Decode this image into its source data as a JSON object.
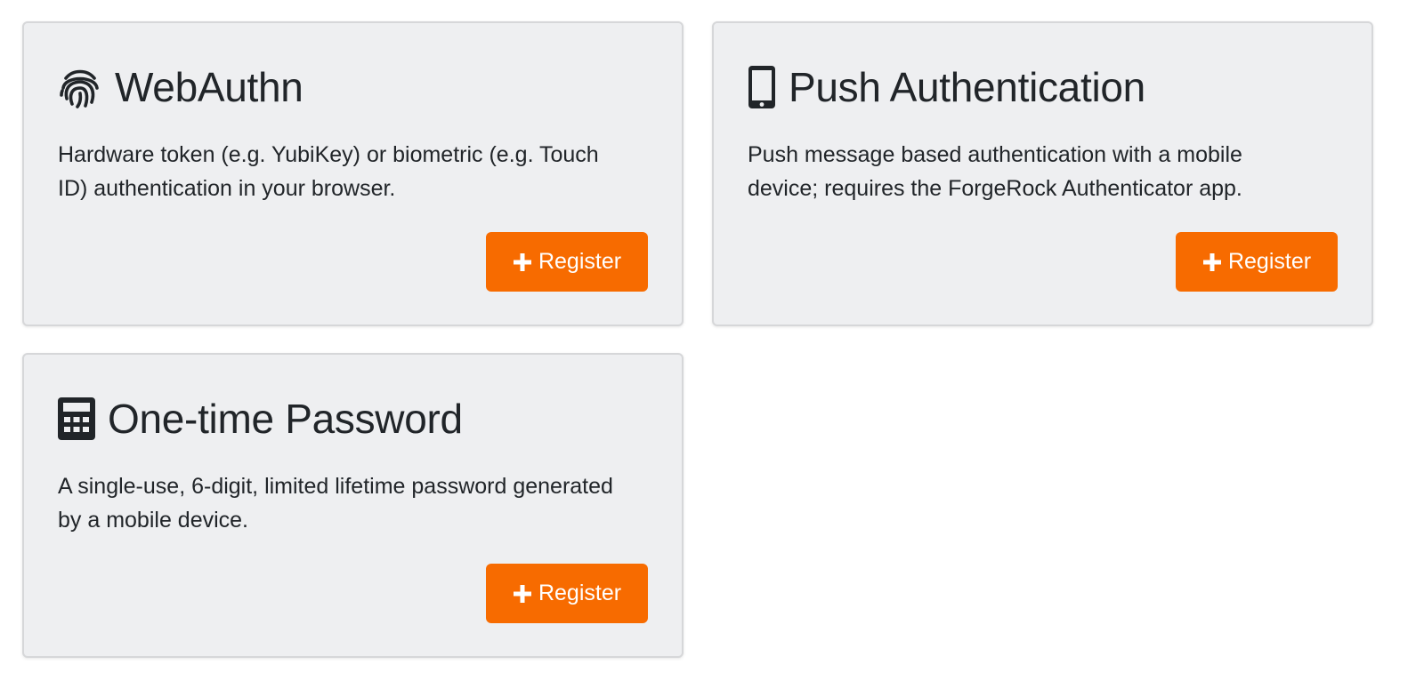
{
  "cards": [
    {
      "title": "WebAuthn",
      "icon": "fingerprint-icon",
      "description": "Hardware token (e.g. YubiKey) or biometric (e.g. Touch ID) authentication in your browser.",
      "button_label": "Register"
    },
    {
      "title": "Push Authentication",
      "icon": "mobile-phone-icon",
      "description": "Push message based authentication with a mobile device; requires the ForgeRock Authenticator app.",
      "button_label": "Register"
    },
    {
      "title": "One-time Password",
      "icon": "calculator-icon",
      "description": "A single-use, 6-digit, limited lifetime password generated by a mobile device.",
      "button_label": "Register"
    }
  ],
  "colors": {
    "accent": "#f76b00",
    "card_background": "#eeeff1",
    "text": "#212529"
  }
}
